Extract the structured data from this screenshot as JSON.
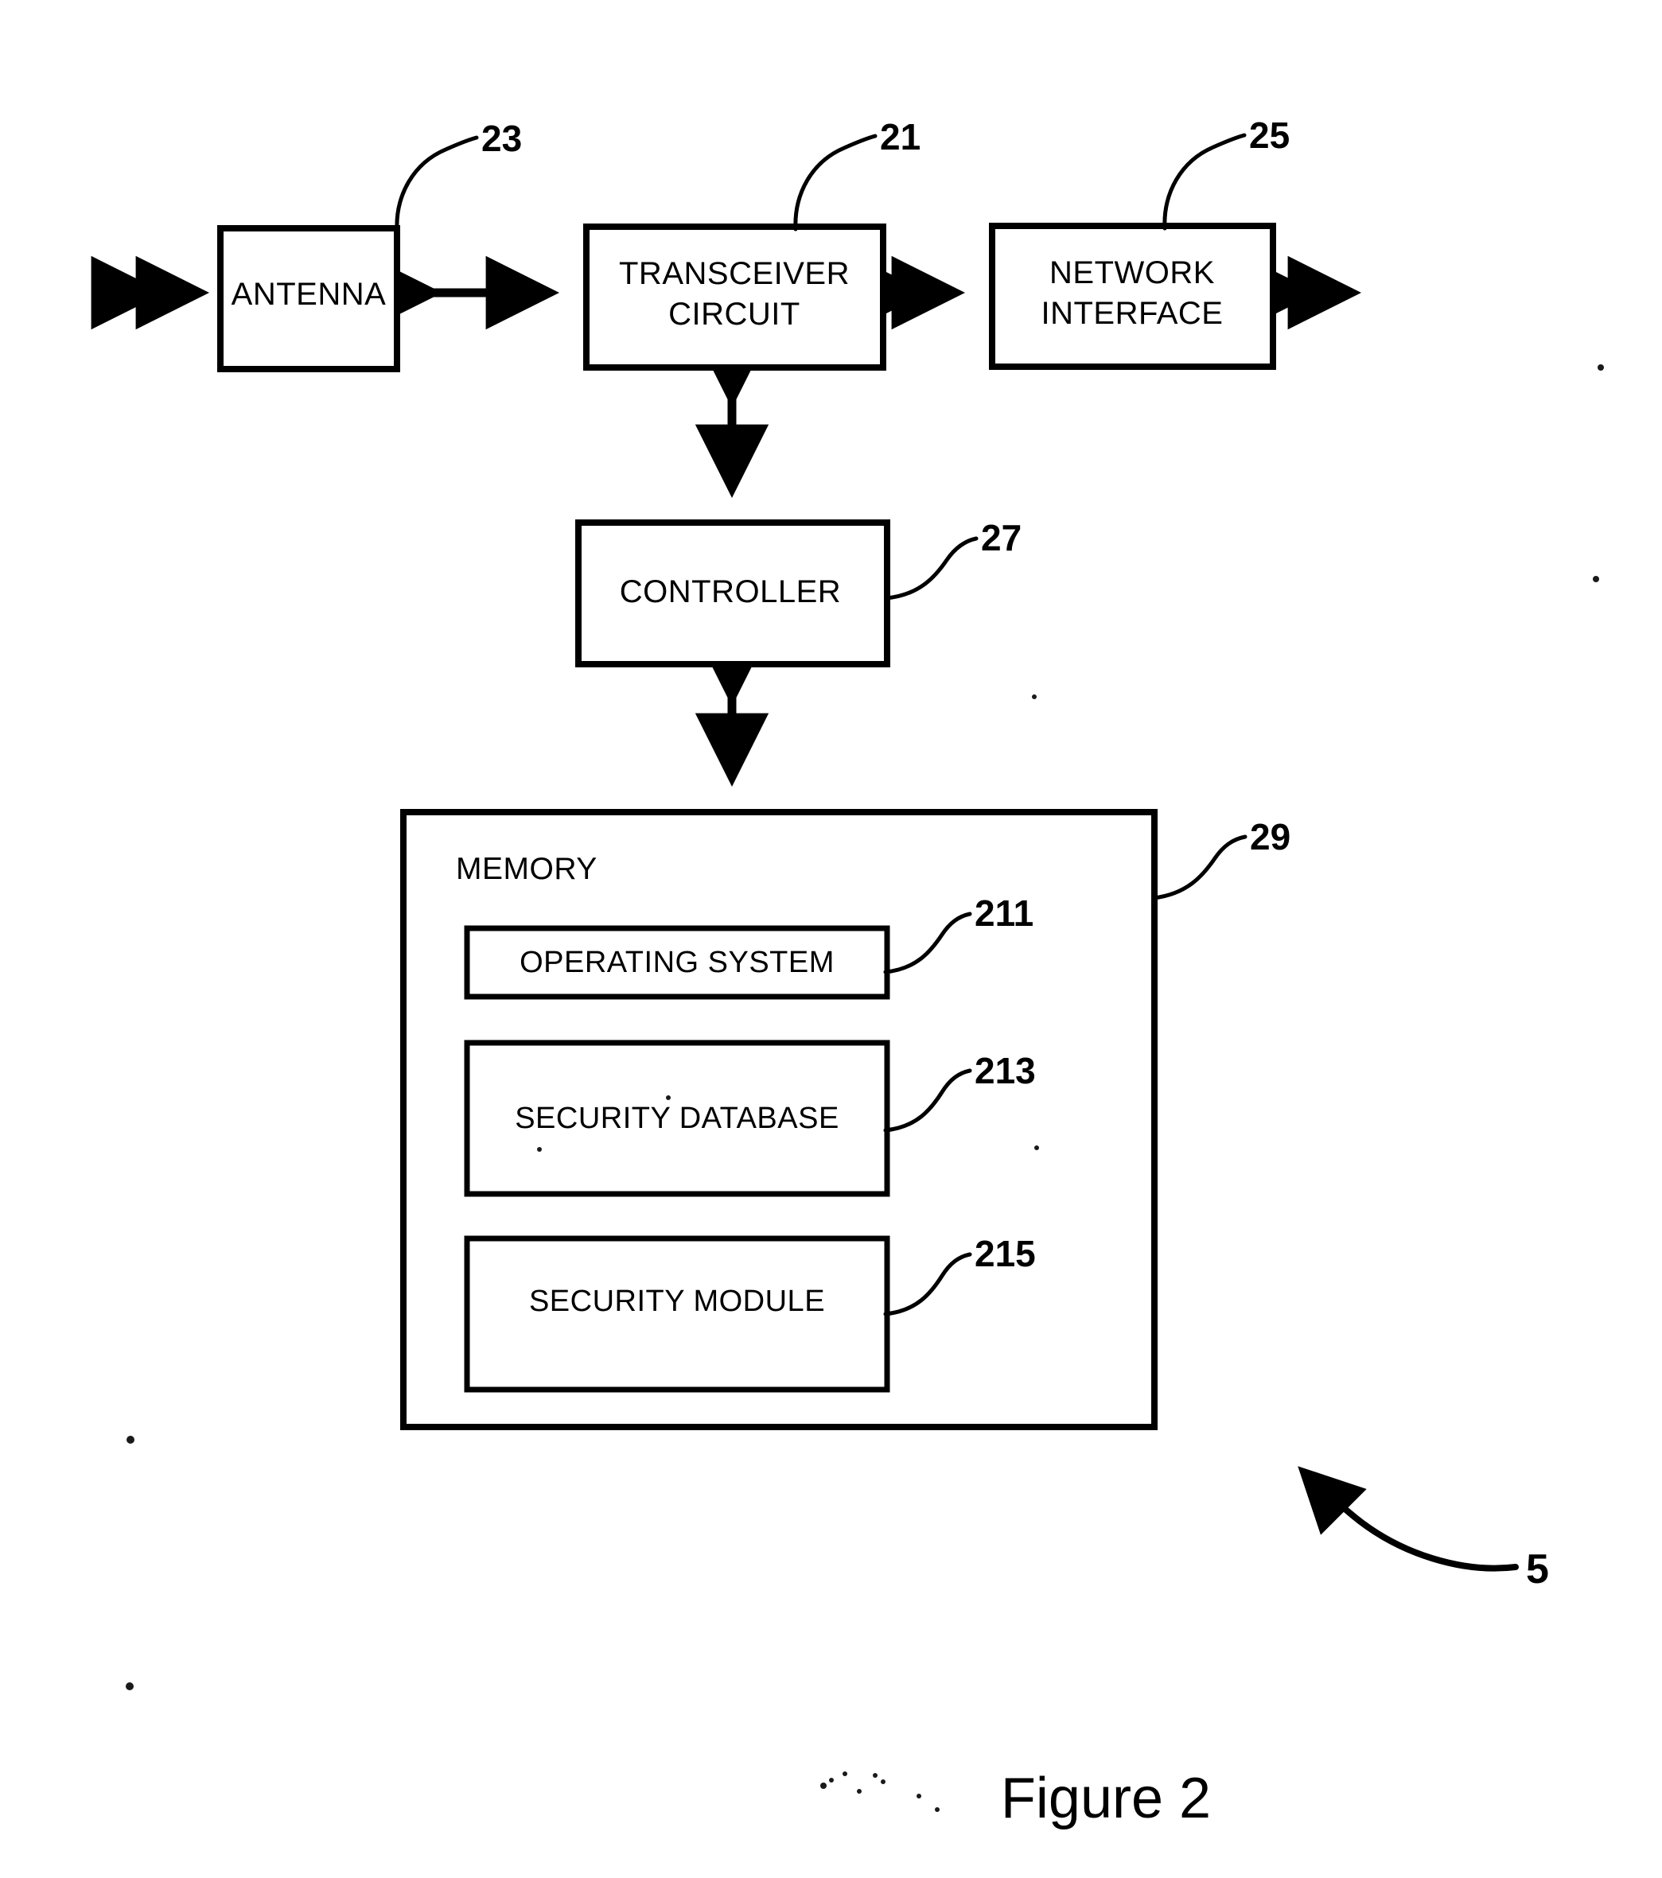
{
  "figure": {
    "caption": "Figure 2",
    "overall_ref": "5"
  },
  "blocks": [
    {
      "id": "antenna",
      "label": "ANTENNA",
      "ref": "23"
    },
    {
      "id": "transceiver",
      "label_line1": "TRANSCEIVER",
      "label_line2": "CIRCUIT",
      "ref": "21"
    },
    {
      "id": "network-interface",
      "label_line1": "NETWORK",
      "label_line2": "INTERFACE",
      "ref": "25"
    },
    {
      "id": "controller",
      "label": "CONTROLLER",
      "ref": "27"
    },
    {
      "id": "memory",
      "label": "MEMORY",
      "ref": "29"
    }
  ],
  "memory_contents": [
    {
      "id": "operating-system",
      "label": "OPERATING SYSTEM",
      "ref": "211"
    },
    {
      "id": "security-database",
      "label": "SECURITY DATABASE",
      "ref": "213"
    },
    {
      "id": "security-module",
      "label": "SECURITY MODULE",
      "ref": "215"
    }
  ],
  "colors": {
    "ink": "#000000",
    "paper": "#ffffff"
  }
}
